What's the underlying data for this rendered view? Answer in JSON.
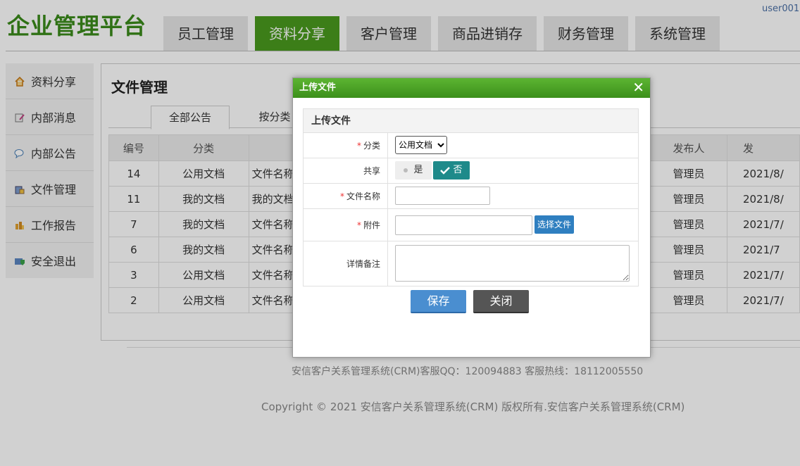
{
  "header": {
    "logo": "企业管理平台",
    "user": "user001,",
    "nav": [
      {
        "label": "员工管理",
        "active": false
      },
      {
        "label": "资料分享",
        "active": true
      },
      {
        "label": "客户管理",
        "active": false
      },
      {
        "label": "商品进销存",
        "active": false
      },
      {
        "label": "财务管理",
        "active": false
      },
      {
        "label": "系统管理",
        "active": false
      }
    ]
  },
  "sidebar": {
    "items": [
      {
        "label": "资料分享",
        "icon": "home-icon"
      },
      {
        "label": "内部消息",
        "icon": "message-edit-icon"
      },
      {
        "label": "内部公告",
        "icon": "speech-bubble-icon"
      },
      {
        "label": "文件管理",
        "icon": "file-folder-icon"
      },
      {
        "label": "工作报告",
        "icon": "report-icon"
      },
      {
        "label": "安全退出",
        "icon": "logout-shield-icon"
      }
    ]
  },
  "main": {
    "title": "文件管理",
    "tabs": [
      "全部公告",
      "按分类"
    ],
    "table": {
      "headers": [
        "编号",
        "分类",
        "",
        "发布人",
        "发"
      ],
      "rows": [
        [
          "14",
          "公用文档",
          "文件名称",
          "管理员",
          "2021/8/"
        ],
        [
          "11",
          "我的文档",
          "我的文档",
          "管理员",
          "2021/8/"
        ],
        [
          "7",
          "我的文档",
          "文件名称",
          "管理员",
          "2021/7/"
        ],
        [
          "6",
          "我的文档",
          "文件名称",
          "管理员",
          "2021/7"
        ],
        [
          "3",
          "公用文档",
          "文件名称",
          "管理员",
          "2021/7/"
        ],
        [
          "2",
          "公用文档",
          "文件名称",
          "管理员",
          "2021/7/"
        ]
      ]
    }
  },
  "footer": {
    "line1": "安信客户关系管理系统(CRM)客服QQ：120094883 客服热线：18112005550",
    "line2": "Copyright © 2021 安信客户关系管理系统(CRM) 版权所有.安信客户关系管理系统(CRM)"
  },
  "modal": {
    "title": "上传文件",
    "close_glyph": "✕",
    "form_title": "上传文件",
    "fields": {
      "category_label": "分类",
      "category_value": "公用文档",
      "share_label": "共享",
      "share_yes": "是",
      "share_no": "否",
      "filename_label": "文件名称",
      "attachment_label": "附件",
      "choose_file": "选择文件",
      "remark_label": "详情备注"
    },
    "save_label": "保存",
    "close_label": "关闭"
  },
  "colors": {
    "brand_green": "#3a8a1a",
    "nav_active": "#4a9a1e",
    "teal": "#1e8a8a",
    "blue": "#4a8ed0"
  }
}
